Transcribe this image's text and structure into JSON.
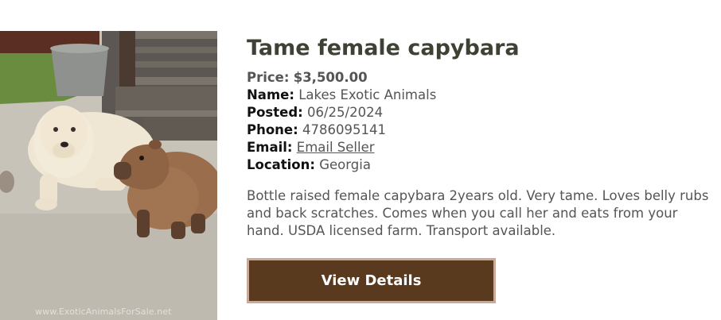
{
  "listing": {
    "title": "Tame female capybara",
    "price_label": "Price:",
    "price_value": "$3,500.00",
    "name_label": "Name:",
    "name_value": "Lakes Exotic Animals",
    "posted_label": "Posted:",
    "posted_value": "06/25/2024",
    "phone_label": "Phone:",
    "phone_value": "4786095141",
    "email_label": "Email:",
    "email_link": "Email Seller",
    "location_label": "Location:",
    "location_value": "Georgia",
    "description": "Bottle raised female capybara 2years old. Very tame. Loves belly rubs and back scratches. Comes when you call her and eats from your hand. USDA licensed farm. Transport available.",
    "button_label": "View Details"
  },
  "photo": {
    "watermark": "www.ExoticAnimalsForSale.net"
  },
  "colors": {
    "title": "#3d4234",
    "button_bg": "#5a3a1f",
    "button_border": "#c9aa98",
    "text": "#555555"
  }
}
